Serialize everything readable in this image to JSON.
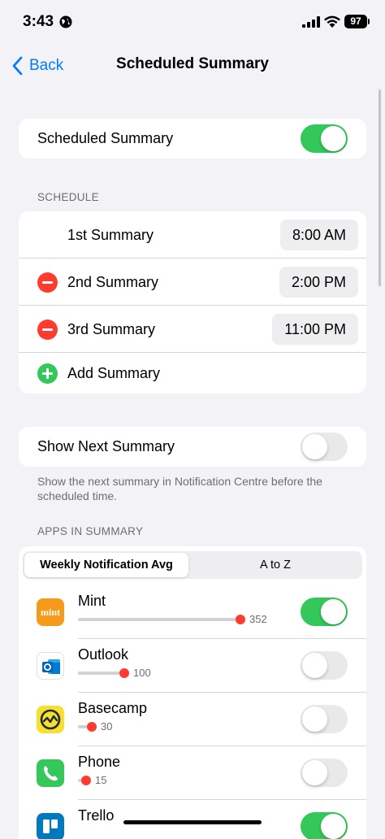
{
  "status_bar": {
    "time": "3:43",
    "battery": "97"
  },
  "nav": {
    "back_label": "Back",
    "title": "Scheduled Summary"
  },
  "main_toggle": {
    "label": "Scheduled Summary",
    "on": true
  },
  "schedule": {
    "header": "SCHEDULE",
    "items": [
      {
        "label": "1st Summary",
        "time": "8:00 AM"
      },
      {
        "label": "2nd Summary",
        "time": "2:00 PM"
      },
      {
        "label": "3rd Summary",
        "time": "11:00 PM"
      }
    ],
    "add_label": "Add Summary"
  },
  "show_next": {
    "label": "Show Next Summary",
    "on": false,
    "footnote": "Show the next summary in Notification Centre before the scheduled time."
  },
  "apps": {
    "header": "APPS IN SUMMARY",
    "segments": [
      "Weekly Notification Avg",
      "A to Z"
    ],
    "selected_segment": "Weekly Notification Avg",
    "items": [
      {
        "name": "Mint",
        "count": "352",
        "level": 1.0,
        "on": true,
        "icon": "mint-icon"
      },
      {
        "name": "Outlook",
        "count": "100",
        "level": 0.284,
        "on": false,
        "icon": "outlook-icon"
      },
      {
        "name": "Basecamp",
        "count": "30",
        "level": 0.085,
        "on": false,
        "icon": "basecamp-icon"
      },
      {
        "name": "Phone",
        "count": "15",
        "level": 0.043,
        "on": false,
        "icon": "phone-icon"
      },
      {
        "name": "Trello",
        "count": "",
        "level": 0,
        "on": true,
        "icon": "trello-icon"
      }
    ],
    "mint_icon_text": "mint"
  },
  "colors": {
    "accent": "#007aff",
    "toggle_on": "#34c759",
    "destructive": "#ff3b30"
  }
}
